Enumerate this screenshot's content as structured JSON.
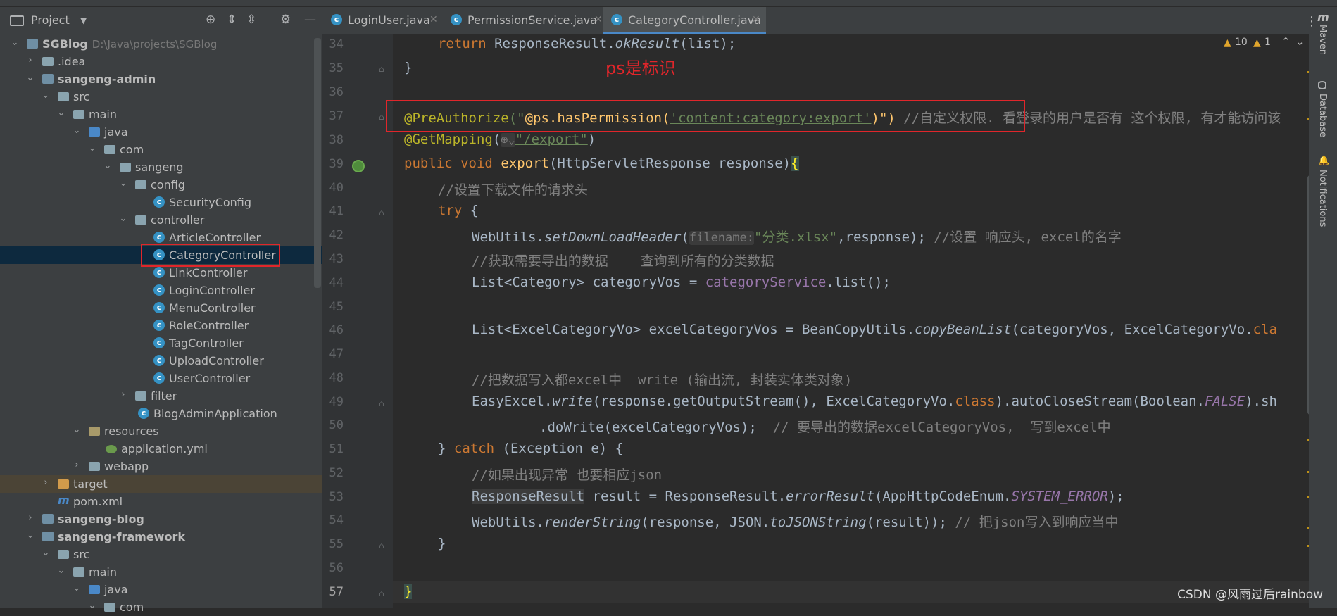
{
  "project_panel": {
    "title": "Project",
    "tree": [
      {
        "label": "SGBlog",
        "path": "D:\\Java\\projects\\SGBlog"
      },
      {
        "label": ".idea"
      },
      {
        "label": "sangeng-admin"
      },
      {
        "label": "src"
      },
      {
        "label": "main"
      },
      {
        "label": "java"
      },
      {
        "label": "com"
      },
      {
        "label": "sangeng"
      },
      {
        "label": "config"
      },
      {
        "label": "SecurityConfig"
      },
      {
        "label": "controller"
      },
      {
        "label": "ArticleController"
      },
      {
        "label": "CategoryController"
      },
      {
        "label": "LinkController"
      },
      {
        "label": "LoginController"
      },
      {
        "label": "MenuController"
      },
      {
        "label": "RoleController"
      },
      {
        "label": "TagController"
      },
      {
        "label": "UploadController"
      },
      {
        "label": "UserController"
      },
      {
        "label": "filter"
      },
      {
        "label": "BlogAdminApplication"
      },
      {
        "label": "resources"
      },
      {
        "label": "application.yml"
      },
      {
        "label": "webapp"
      },
      {
        "label": "target"
      },
      {
        "label": "pom.xml"
      },
      {
        "label": "sangeng-blog"
      },
      {
        "label": "sangeng-framework"
      },
      {
        "label": "src"
      },
      {
        "label": "main"
      },
      {
        "label": "java"
      },
      {
        "label": "com"
      }
    ]
  },
  "tabs": [
    {
      "label": "LoginUser.java"
    },
    {
      "label": "PermissionService.java"
    },
    {
      "label": "CategoryController.java"
    }
  ],
  "inspections": {
    "warnings": "10",
    "weak_warnings": "1"
  },
  "side_tools": {
    "maven": "Maven",
    "database": "Database",
    "notifications": "Notifications"
  },
  "annotation_note": "ps是标识",
  "line_numbers": [
    "34",
    "35",
    "36",
    "37",
    "38",
    "39",
    "40",
    "41",
    "42",
    "43",
    "44",
    "45",
    "46",
    "47",
    "48",
    "49",
    "50",
    "51",
    "52",
    "53",
    "54",
    "55",
    "56",
    "57"
  ],
  "code": {
    "l34": {
      "kw": "return",
      "rest": " ResponseResult.",
      "call": "okResult",
      "end": "(list);"
    },
    "l35": "}",
    "l37": {
      "ann": "@PreAuthorize",
      "a": "(\"",
      "b": "@ps.hasPermission(",
      "c": "'content:category:export'",
      "d": ")\")",
      "cmt": " //自定义权限. 看登录的用户是否有 这个权限, 有才能访问该"
    },
    "l38": {
      "ann": "@GetMapping",
      "a": "(",
      "b": "\"/export\"",
      "c": ")"
    },
    "l39": {
      "kw1": "public",
      "kw2": "void",
      "fn": "export",
      "rest": "(HttpServletResponse response)",
      "brace": "{"
    },
    "l40": "//设置下载文件的请求头",
    "l41": {
      "kw": "try",
      "rest": " {"
    },
    "l42": {
      "a": "WebUtils.",
      "call": "setDownLoadHeader",
      "b": "(",
      "hint": "filename:",
      "str": "\"分类.xlsx\"",
      "c": ",response);",
      "cmt": " //设置 响应头, excel的名字"
    },
    "l43": "//获取需要导出的数据    查询到所有的分类数据",
    "l44": {
      "a": "List<Category> categoryVos = ",
      "fld": "categoryService",
      "b": ".list();"
    },
    "l46": {
      "a": "List<ExcelCategoryVo> excelCategoryVos = BeanCopyUtils.",
      "call": "copyBeanList",
      "b": "(categoryVos, ExcelCategoryVo.",
      "kw": "cla"
    },
    "l48": "//把数据写入都excel中  write (输出流, 封装实体类对象)",
    "l49": {
      "a": "EasyExcel.",
      "call": "write",
      "b": "(response.getOutputStream(), ExcelCategoryVo.",
      "kw": "class",
      "c": ").autoCloseStream(Boolean.",
      "fld": "FALSE",
      "d": ").sh"
    },
    "l50": {
      "a": ".doWrite(excelCategoryVos);",
      "cmt": "  // 要导出的数据excelCategoryVos,  写到excel中"
    },
    "l51": {
      "a": "} ",
      "kw": "catch",
      "b": " (Exception e) {"
    },
    "l52": "//如果出现异常 也要相应json",
    "l53": {
      "a": "ResponseResult",
      "b": " result = ResponseResult.",
      "call": "errorResult",
      "c": "(AppHttpCodeEnum.",
      "fld": "SYSTEM_ERROR",
      "d": ");"
    },
    "l54": {
      "a": "WebUtils.",
      "call": "renderString",
      "b": "(response, JSON.",
      "call2": "toJSONString",
      "c": "(result));",
      "cmt": " // 把json写入到响应当中"
    },
    "l55": "}",
    "l57": "}"
  },
  "watermark": "CSDN @风雨过后rainbow",
  "colors": {
    "keyword": "#cc7832",
    "annotation": "#bbb529",
    "string": "#6a8759",
    "comment": "#808080",
    "highlight_red": "#e0262b"
  }
}
